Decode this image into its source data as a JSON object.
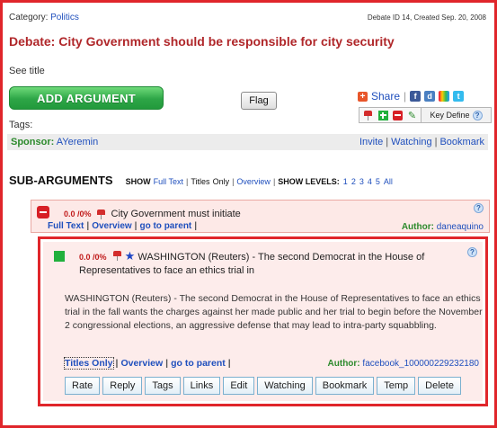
{
  "header": {
    "category_label": "Category:",
    "category_value": "Politics",
    "debate_meta": "Debate ID 14, Created Sep. 20, 2008",
    "debate_title": "Debate: City Government should be responsible for city security",
    "see_title": "See title",
    "add_argument": "ADD ARGUMENT",
    "flag": "Flag",
    "share": "Share",
    "key_define": "Key Define",
    "tags": "Tags:",
    "sponsor_label": "Sponsor:",
    "sponsor_name": "AYeremin",
    "invite": "Invite",
    "watching": "Watching",
    "bookmark": "Bookmark"
  },
  "sub": {
    "title": "SUB-ARGUMENTS",
    "show": "SHOW",
    "full_text": "Full Text",
    "titles": "Titles",
    "only": "Only",
    "overview": "Overview",
    "show_levels": "SHOW LEVELS:",
    "levels": [
      "1",
      "2",
      "3",
      "4",
      "5",
      "All"
    ]
  },
  "arg1": {
    "score": "0.0 /0%",
    "title": "City Government must initiate",
    "full_text": "Full Text",
    "overview": "Overview",
    "go_parent": "go to parent",
    "author_label": "Author:",
    "author": "daneaquino"
  },
  "arg2": {
    "score": "0.0 /0%",
    "title": "WASHINGTON (Reuters) - The second Democrat in the House of Representatives to face an ethics trial in",
    "body": "WASHINGTON (Reuters) - The second Democrat in the House of Representatives to face an ethics trial in the fall wants the charges against her made public and her trial to begin before the November 2 congressional elections, an aggressive defense that may lead to intra-party squabbling.",
    "titles_only": "Titles Only",
    "overview": "Overview",
    "go_parent": "go to parent",
    "author_label": "Author:",
    "author": "facebook_100000229232180",
    "buttons": [
      "Rate",
      "Reply",
      "Tags",
      "Links",
      "Edit",
      "Watching",
      "Bookmark",
      "Temp",
      "Delete"
    ]
  },
  "colors": {
    "title_red": "#b0272a",
    "link_blue": "#1f4fbd",
    "green": "#2c8a2c",
    "frame_red": "#e0262b"
  }
}
